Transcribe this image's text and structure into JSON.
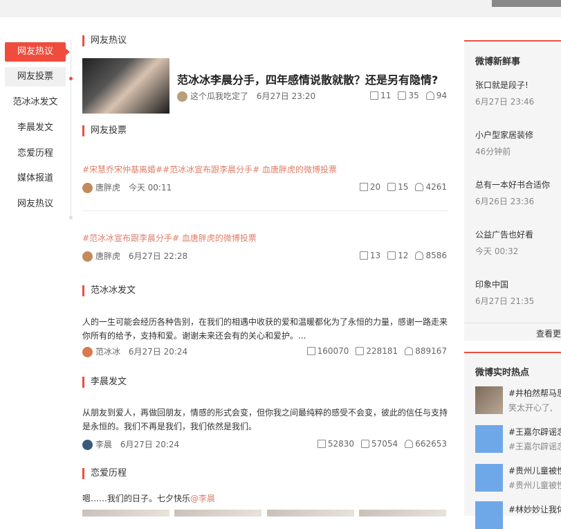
{
  "nav": {
    "items": [
      "网友热议",
      "网友投票",
      "范冰冰发文",
      "李晨发文",
      "恋爱历程",
      "媒体报道",
      "网友热议"
    ]
  },
  "sections": {
    "s1": "网友热议",
    "s2": "网友投票",
    "s3": "范冰冰发文",
    "s4": "李晨发文",
    "s5": "恋爱历程"
  },
  "featured": {
    "headline": "范冰冰李晨分手，四年感情说散就散？还是另有隐情?",
    "author": "这个瓜我吃定了",
    "time": "6月27日 23:20",
    "shares": "11",
    "comments": "35",
    "likes": "94"
  },
  "vote1": {
    "tags": "#宋慧乔宋仲基离婚##范冰冰宣布跟李晨分手# 血唐胖虎的微博投票",
    "author": "唐胖虎",
    "time": "今天 00:11",
    "shares": "20",
    "comments": "15",
    "likes": "4261"
  },
  "vote2": {
    "tags": "#范冰冰宣布跟李晨分手# 血唐胖虎的微博投票",
    "author": "唐胖虎",
    "time": "6月27日 22:28",
    "shares": "13",
    "comments": "12",
    "likes": "8586"
  },
  "fan_post": {
    "text": "人的一生可能会经历各种告别，在我们的相遇中收获的爱和温暖都化为了永恒的力量，感谢一路走来你所有的给予，支持和爱。谢谢未来还会有的关心和爱护。...",
    "author": "范冰冰",
    "time": "6月27日 20:24",
    "shares": "160070",
    "comments": "228181",
    "likes": "889167"
  },
  "li_post": {
    "text": "从朋友到爱人，再做回朋友，情感的形式会变，但你我之间最纯粹的感受不会变，彼此的信任与支持是永恒的。我们不再是我们，我们依然是我们。",
    "author": "李晨",
    "time": "6月27日 20:24",
    "shares": "52830",
    "comments": "57054",
    "likes": "662653"
  },
  "love": {
    "text": "嗯……我们的日子。七夕快乐",
    "mention": "@李晨"
  },
  "fresh": {
    "title": "微博新鲜事",
    "items": [
      {
        "title": "张口就是段子!",
        "time": "6月27日 23:46"
      },
      {
        "title": "小户型家居装修",
        "time": "46分钟前"
      },
      {
        "title": "总有一本好书合适你",
        "time": "6月26日 23:36"
      },
      {
        "title": "公益广告也好看",
        "time": "今天 00:32"
      },
      {
        "title": "印象中国",
        "time": "6月27日 21:35"
      }
    ],
    "more": "查看更"
  },
  "hot": {
    "title": "微博实时热点",
    "items": [
      {
        "line1": "#井柏然帮马思",
        "line2": "笑太开心了,"
      },
      {
        "line1": "#王嘉尔辟谣恋",
        "line2": "#王嘉尔辟谣恋"
      },
      {
        "line1": "#贵州儿童被性",
        "line2": "#贵州儿童被性"
      },
      {
        "line1": "#林妙妙让我体",
        "line2": ""
      }
    ]
  },
  "colors": {
    "accent": "#f04c3d",
    "tag": "#e07e6a"
  }
}
